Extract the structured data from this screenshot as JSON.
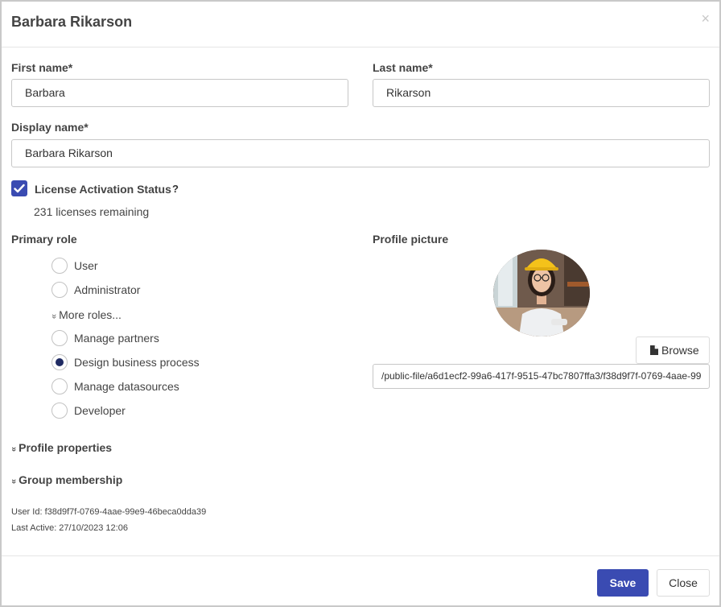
{
  "dialog": {
    "title": "Barbara Rikarson",
    "close_icon": "×"
  },
  "form": {
    "first_name": {
      "label": "First name*",
      "value": "Barbara"
    },
    "last_name": {
      "label": "Last name*",
      "value": "Rikarson"
    },
    "display_name": {
      "label": "Display name*",
      "value": "Barbara Rikarson"
    }
  },
  "license": {
    "label": "License Activation Status",
    "help": "?",
    "checked": true,
    "remaining": "231 licenses remaining"
  },
  "primary_role": {
    "label": "Primary role",
    "roles": [
      {
        "label": "User",
        "checked": false
      },
      {
        "label": "Administrator",
        "checked": false
      }
    ],
    "more_roles": "More roles...",
    "extra_roles": [
      {
        "label": "Manage partners",
        "checked": false
      },
      {
        "label": "Design business process",
        "checked": true
      },
      {
        "label": "Manage datasources",
        "checked": false
      },
      {
        "label": "Developer",
        "checked": false
      }
    ]
  },
  "profile_picture": {
    "label": "Profile picture",
    "browse": "Browse",
    "path": "/public-file/a6d1ecf2-99a6-417f-9515-47bc7807ffa3/f38d9f7f-0769-4aae-99"
  },
  "sections": {
    "profile_properties": "Profile properties",
    "group_membership": "Group membership"
  },
  "meta": {
    "user_id": "User Id: f38d9f7f-0769-4aae-99e9-46beca0dda39",
    "last_active": "Last Active: 27/10/2023 12:06"
  },
  "footer": {
    "save": "Save",
    "close": "Close"
  },
  "colors": {
    "accent": "#3a4bb2",
    "radio_selected": "#1f2a62"
  }
}
